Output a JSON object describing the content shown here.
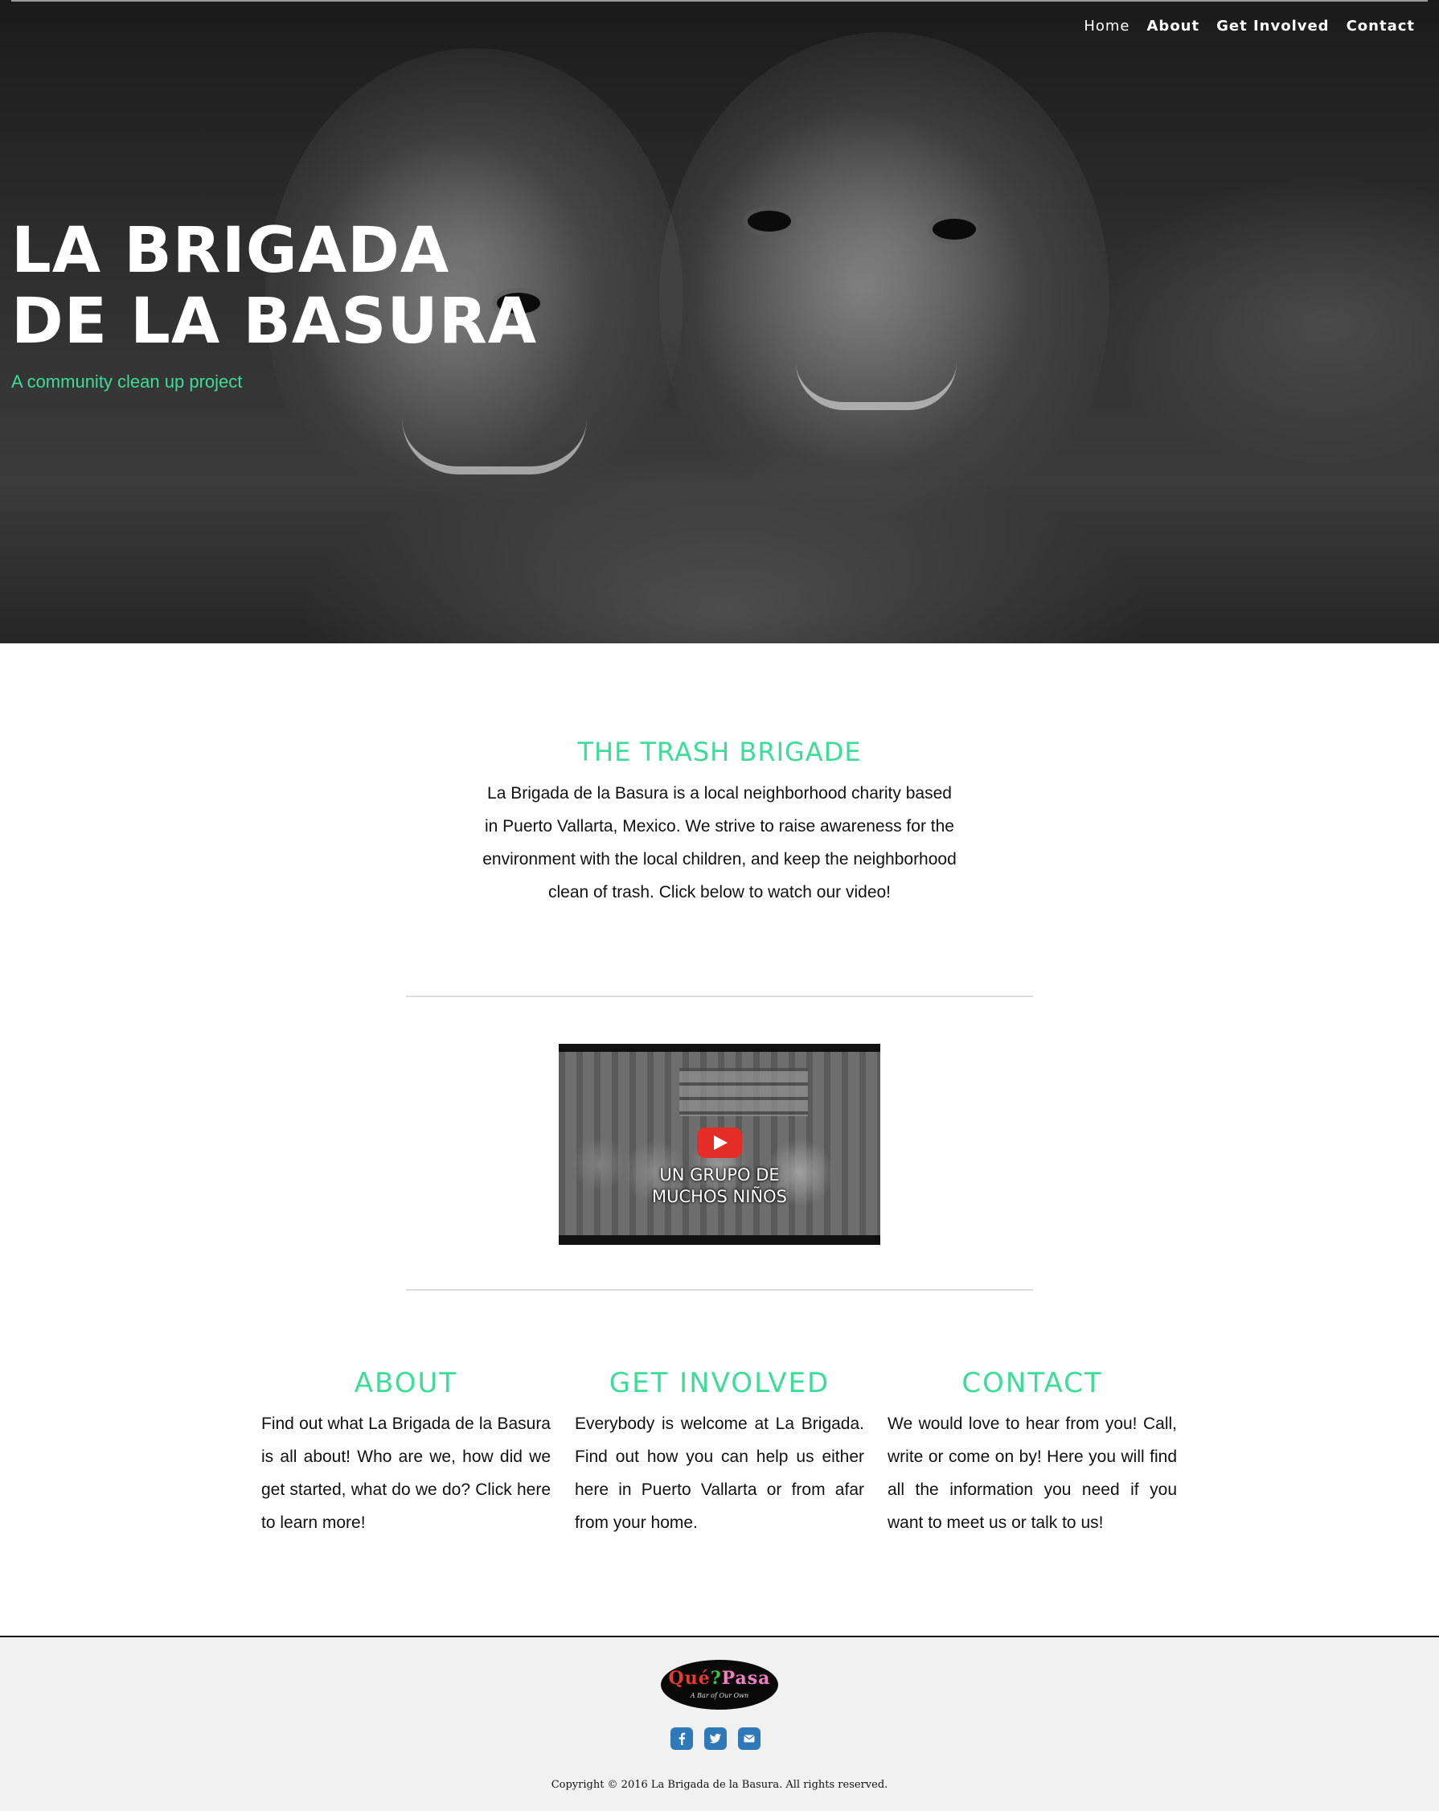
{
  "nav": {
    "items": [
      {
        "label": "Home"
      },
      {
        "label": "About"
      },
      {
        "label": "Get Involved"
      },
      {
        "label": "Contact"
      }
    ]
  },
  "hero": {
    "title_line1": "LA BRIGADA",
    "title_line2": "DE LA BASURA",
    "subtitle": "A community clean up project"
  },
  "intro": {
    "title": "THE TRASH BRIGADE",
    "text": "La Brigada de la Basura is a local neighborhood charity based in Puerto Vallarta, Mexico. We strive to raise awareness for the environment with the local children, and keep the neighborhood clean of trash. Click below to watch our video!"
  },
  "video": {
    "caption_line1": "UN GRUPO DE",
    "caption_line2": "MUCHOS NIÑOS"
  },
  "columns": [
    {
      "title": "ABOUT",
      "text": "Find out what La Brigada de la Basura is all about! Who are we, how did we get started, what do we do? Click here to learn more!"
    },
    {
      "title": "GET INVOLVED",
      "text": "Everybody is welcome at La Brigada. Find out how you can help us either here in Puerto Vallarta or from afar from your home."
    },
    {
      "title": "CONTACT",
      "text": "We would love to hear from you! Call, write or come on by! Here you will find all the information you need if you want to meet us or talk to us!"
    }
  ],
  "footer": {
    "logo_word1": "Qué",
    "logo_word2": "Pasa",
    "logo_tagline": "A Bar of Our Own",
    "social_icons": [
      "facebook-icon",
      "twitter-icon",
      "email-icon"
    ],
    "copyright": "Copyright © 2016 La Brigada de la Basura. All rights reserved."
  },
  "colors": {
    "accent": "#3ddc97",
    "social_blue": "#2f79b9",
    "footer_bg": "#f1f1f1"
  }
}
